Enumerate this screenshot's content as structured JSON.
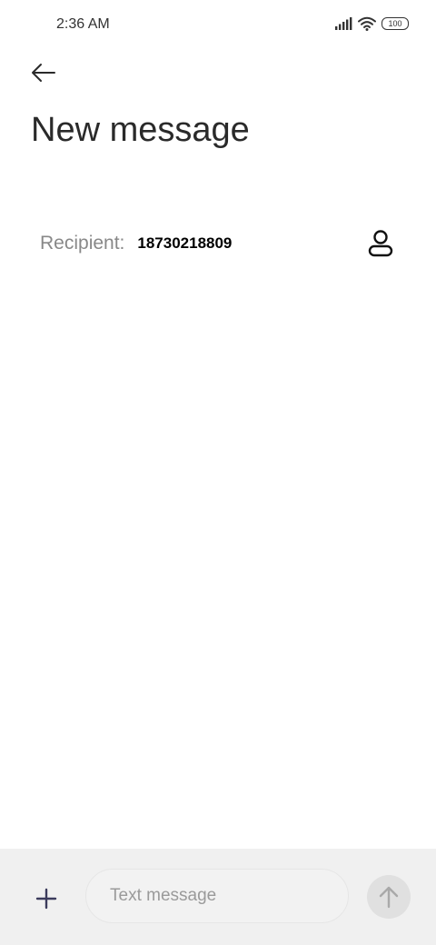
{
  "status_bar": {
    "time": "2:36 AM",
    "battery": "100"
  },
  "header": {
    "title": "New message"
  },
  "recipient": {
    "label": "Recipient:",
    "value": "18730218809"
  },
  "composer": {
    "placeholder": "Text message"
  },
  "icons": {
    "back": "back-arrow-icon",
    "contact": "contact-person-icon",
    "attach": "plus-icon",
    "send": "send-arrow-up-icon",
    "signal": "signal-icon",
    "wifi": "wifi-icon",
    "battery": "battery-icon"
  },
  "colors": {
    "background": "#ffffff",
    "bottom_bar": "#f0f0f0",
    "input_bg": "#f2f2f2",
    "send_button": "#e0e0e0",
    "attach_icon": "#3b3b5c",
    "label_gray": "#888888"
  }
}
